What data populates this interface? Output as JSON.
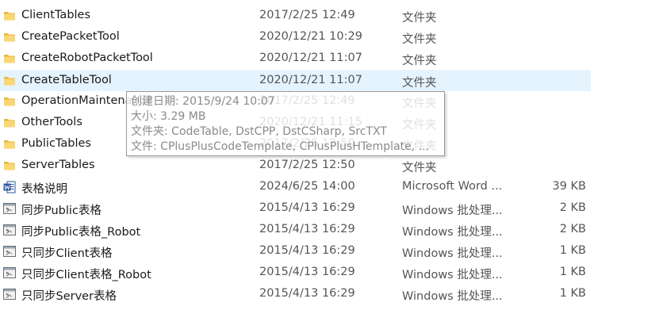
{
  "files": [
    {
      "name": "ClientTables",
      "date": "2017/2/25 12:49",
      "type": "文件夹",
      "size": "",
      "icon": "folder-icon"
    },
    {
      "name": "CreatePacketTool",
      "date": "2020/12/21 10:29",
      "type": "文件夹",
      "size": "",
      "icon": "folder-icon"
    },
    {
      "name": "CreateRobotPacketTool",
      "date": "2020/12/21 11:07",
      "type": "文件夹",
      "size": "",
      "icon": "folder-icon"
    },
    {
      "name": "CreateTableTool",
      "date": "2020/12/21 11:07",
      "type": "文件夹",
      "size": "",
      "icon": "folder-icon",
      "selected": true
    },
    {
      "name": "OperationMaintenance",
      "date": "2017/2/25 12:49",
      "type": "文件夹",
      "size": "",
      "icon": "folder-icon"
    },
    {
      "name": "OtherTools",
      "date": "2020/12/21 11:15",
      "type": "文件夹",
      "size": "",
      "icon": "folder-icon"
    },
    {
      "name": "PublicTables",
      "date": "2017/2/25 12:50",
      "type": "文件夹",
      "size": "",
      "icon": "folder-icon"
    },
    {
      "name": "ServerTables",
      "date": "2017/2/25 12:50",
      "type": "文件夹",
      "size": "",
      "icon": "folder-icon"
    },
    {
      "name": "表格说明",
      "date": "2024/6/25 14:00",
      "type": "Microsoft Word ...",
      "size": "39 KB",
      "icon": "word-document-icon"
    },
    {
      "name": "同步Public表格",
      "date": "2015/4/13 16:29",
      "type": "Windows 批处理...",
      "size": "2 KB",
      "icon": "batch-file-icon"
    },
    {
      "name": "同步Public表格_Robot",
      "date": "2015/4/13 16:29",
      "type": "Windows 批处理...",
      "size": "2 KB",
      "icon": "batch-file-icon"
    },
    {
      "name": "只同步Client表格",
      "date": "2015/4/13 16:29",
      "type": "Windows 批处理...",
      "size": "1 KB",
      "icon": "batch-file-icon"
    },
    {
      "name": "只同步Client表格_Robot",
      "date": "2015/4/13 16:29",
      "type": "Windows 批处理...",
      "size": "1 KB",
      "icon": "batch-file-icon"
    },
    {
      "name": "只同步Server表格",
      "date": "2015/4/13 16:29",
      "type": "Windows 批处理...",
      "size": "1 KB",
      "icon": "batch-file-icon"
    }
  ],
  "tooltip": {
    "created": "创建日期: 2015/9/24 10:07",
    "size": "大小: 3.29 MB",
    "folders": "文件夹: CodeTable, DstCPP, DstCSharp, SrcTXT",
    "files": "文件: CPlusPlusCodeTemplate, CPlusPlusHTemplate, ..."
  },
  "colors": {
    "selection": "#e5f3ff",
    "folder": "#f8d775",
    "folder_dark": "#e8b83c",
    "word": "#2b579a"
  }
}
